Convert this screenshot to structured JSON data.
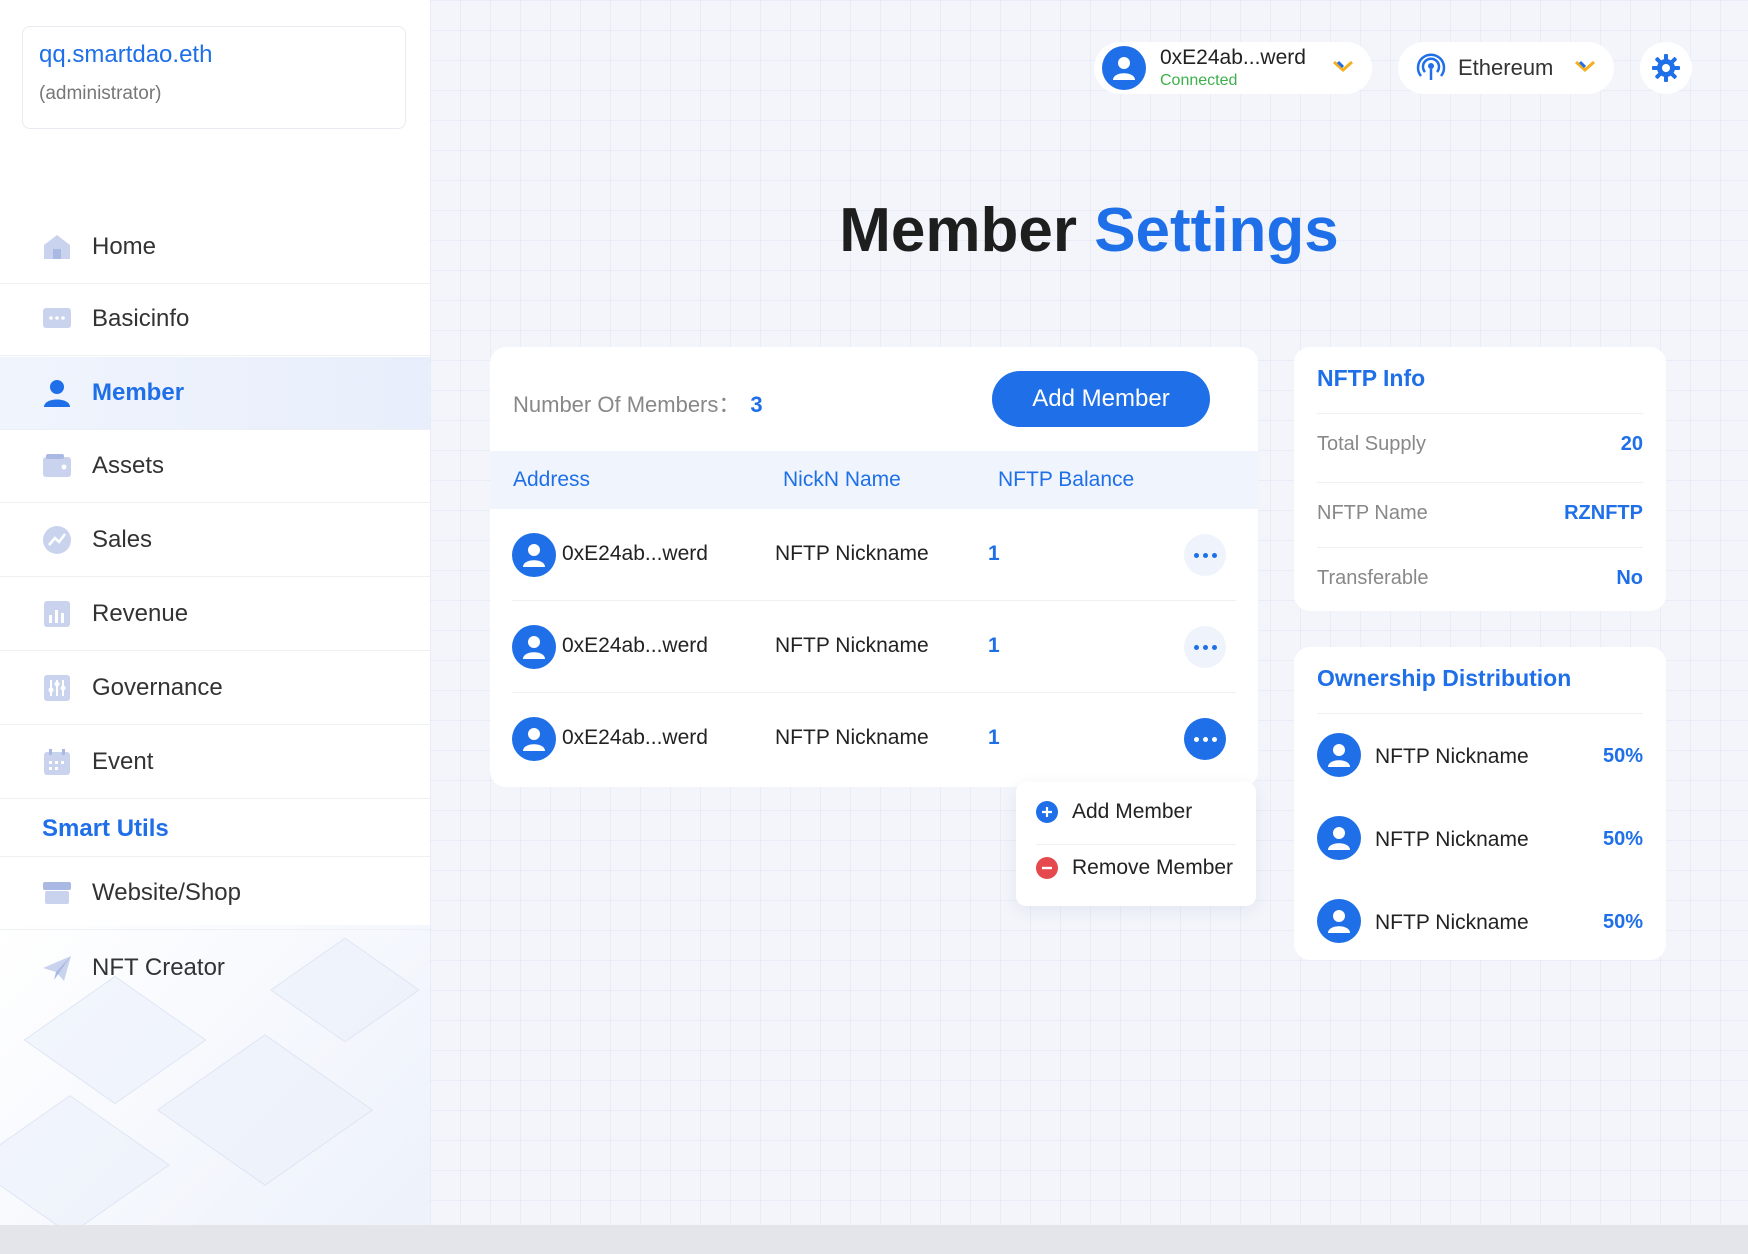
{
  "org": {
    "name": "qq.smartdao.eth",
    "role": "(administrator)"
  },
  "sidebar": {
    "items": [
      {
        "label": "Home",
        "icon": "home-icon"
      },
      {
        "label": "Basicinfo",
        "icon": "info-icon"
      },
      {
        "label": "Member",
        "icon": "user-icon",
        "active": true
      },
      {
        "label": "Assets",
        "icon": "wallet-icon"
      },
      {
        "label": "Sales",
        "icon": "sales-icon"
      },
      {
        "label": "Revenue",
        "icon": "chart-icon"
      },
      {
        "label": "Governance",
        "icon": "sliders-icon"
      },
      {
        "label": "Event",
        "icon": "calendar-icon"
      }
    ],
    "section": "Smart Utils",
    "utils": [
      {
        "label": "Website/Shop",
        "icon": "shop-icon"
      },
      {
        "label": "NFT Creator",
        "icon": "send-icon"
      }
    ]
  },
  "header": {
    "wallet": {
      "address": "0xE24ab...werd",
      "status": "Connected"
    },
    "network": {
      "label": "Ethereum"
    }
  },
  "title": {
    "main": "Member",
    "accent": "Settings"
  },
  "members": {
    "count_label": "Number Of Members：",
    "count": "3",
    "add_button": "Add Member",
    "columns": [
      "Address",
      "NickN Name",
      "NFTP Balance"
    ],
    "rows": [
      {
        "address": "0xE24ab...werd",
        "nickname": "NFTP Nickname",
        "balance": "1"
      },
      {
        "address": "0xE24ab...werd",
        "nickname": "NFTP Nickname",
        "balance": "1"
      },
      {
        "address": "0xE24ab...werd",
        "nickname": "NFTP Nickname",
        "balance": "1"
      }
    ]
  },
  "dropdown": {
    "add": "Add Member",
    "remove": "Remove Member"
  },
  "nftp_info": {
    "title": "NFTP Info",
    "rows": [
      {
        "key": "Total Supply",
        "value": "20"
      },
      {
        "key": "NFTP Name",
        "value": "RZNFTP"
      },
      {
        "key": "Transferable",
        "value": "No"
      }
    ]
  },
  "ownership": {
    "title": "Ownership Distribution",
    "rows": [
      {
        "nickname": "NFTP Nickname",
        "percent": "50%"
      },
      {
        "nickname": "NFTP Nickname",
        "percent": "50%"
      },
      {
        "nickname": "NFTP Nickname",
        "percent": "50%"
      }
    ]
  },
  "colors": {
    "accent": "#1e6fe8",
    "connected": "#3cb04a",
    "danger": "#e5484d",
    "chevron": "#f5b021"
  }
}
